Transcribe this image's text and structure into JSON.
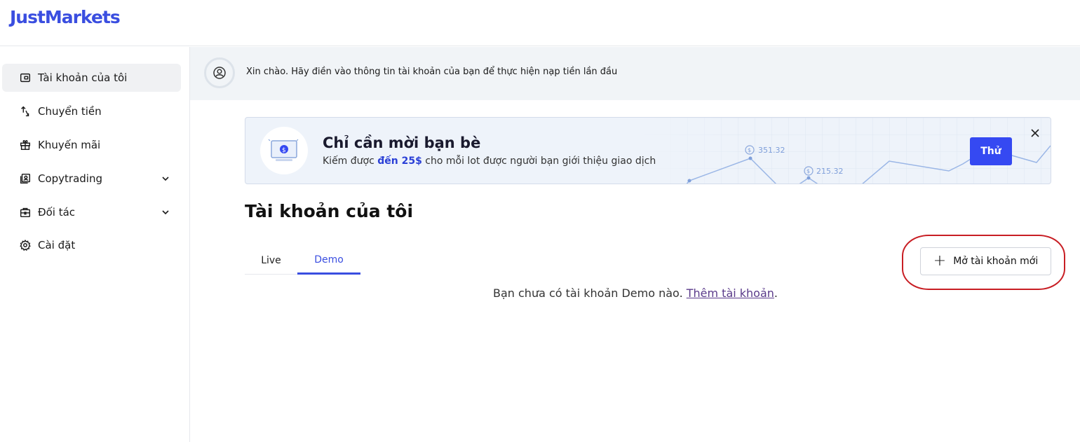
{
  "app": {
    "logo": "JustMarkets"
  },
  "sidebar": {
    "items": [
      {
        "label": "Tài khoản của tôi",
        "icon": "wallet-icon",
        "active": true
      },
      {
        "label": "Chuyển tiền",
        "icon": "transfer-icon"
      },
      {
        "label": "Khuyến mãi",
        "icon": "gift-icon"
      },
      {
        "label": "Copytrading",
        "icon": "copytrading-icon",
        "expandable": true
      },
      {
        "label": "Đối tác",
        "icon": "briefcase-icon",
        "expandable": true
      },
      {
        "label": "Cài đặt",
        "icon": "gear-icon"
      }
    ]
  },
  "notice": {
    "text": "Xin chào. Hãy điền vào thông tin tài khoản của bạn để thực hiện nạp tiền lần đầu",
    "icon": "user-icon"
  },
  "banner": {
    "title": "Chỉ cần mời bạn bè",
    "sub_prefix": "Kiếm được ",
    "sub_highlight": "đến 25$",
    "sub_suffix": " cho mỗi lot được người bạn giới thiệu giao dịch",
    "button_label": "Thử",
    "chart_label_1": "351.32",
    "chart_label_2": "215.32",
    "accent": "#3549f2"
  },
  "main": {
    "title": "Tài khoản của tôi",
    "tabs": [
      {
        "label": "Live",
        "active": false
      },
      {
        "label": "Demo",
        "active": true
      }
    ],
    "open_button": "Mở tài khoản mới",
    "empty_text": "Bạn chưa có tài khoản Demo nào. ",
    "empty_link": "Thêm tài khoản",
    "empty_period": "."
  }
}
